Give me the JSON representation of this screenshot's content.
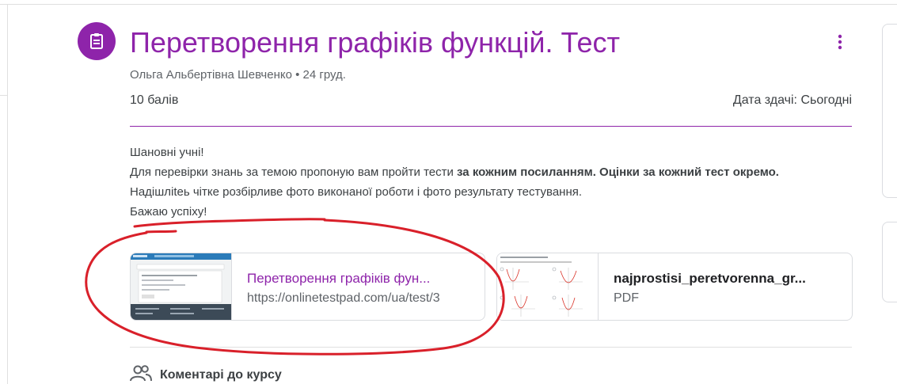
{
  "assignment": {
    "title": "Перетворення графіків функцій. Тест",
    "author": "Ольга Альбертівна Шевченко",
    "date": "24 груд.",
    "points": "10 балів",
    "due": "Дата здачі: Сьогодні"
  },
  "description": {
    "line1": "Шановні учні!",
    "line2_normal": "Для перевірки знань за темою  пропоную  вам  пройти  тести ",
    "line2_bold": "за кожним посиланням. Оцінки за кожний тест окремо.",
    "line3": "Надішліteь чітке розбірливе фото виконаної роботи і фото результату тестування.",
    "line4": "Бажаю успіху!"
  },
  "attachments": [
    {
      "title": "Перетворення графіків фун...",
      "subtitle": "https://onlinetestpad.com/ua/test/3",
      "type": "link"
    },
    {
      "title": "najprostisi_peretvorenna_gr...",
      "subtitle": "PDF",
      "type": "file"
    }
  ],
  "comments": {
    "label": "Коментарі до курсу"
  },
  "icons": {
    "assignment": "assignment-icon",
    "more": "more-vert-icon",
    "people": "people-icon"
  },
  "colors": {
    "accent": "#8e24aa",
    "annotation": "#d9202a"
  }
}
